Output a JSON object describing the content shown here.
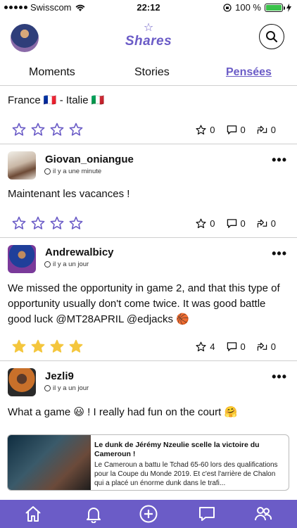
{
  "statusbar": {
    "carrier": "Swisscom",
    "time": "22:12",
    "battery": "100 %"
  },
  "header": {
    "logo_text": "Shares"
  },
  "tabs": [
    {
      "label": "Moments"
    },
    {
      "label": "Stories"
    },
    {
      "label": "Pensées",
      "active": true
    }
  ],
  "posts": [
    {
      "text": "France 🇫🇷 - Italie 🇮🇹",
      "stars_filled": 0,
      "likes": "0",
      "comments": "0",
      "shares": "0"
    },
    {
      "author": "Giovan_oniangue",
      "time": "il y a une minute",
      "text": "Maintenant les vacances !",
      "stars_filled": 0,
      "likes": "0",
      "comments": "0",
      "shares": "0"
    },
    {
      "author": "Andrewalbicy",
      "time": "il y a un jour",
      "text": "We missed the opportunity in game 2, and that this type of opportunity usually don't come twice. It was good battle good luck @MT28APRIL @edjacks 🏀",
      "stars_filled": 4,
      "likes": "4",
      "comments": "0",
      "shares": "0"
    },
    {
      "author": "Jezli9",
      "time": "il y a un jour",
      "text": "What a game 😃 ! I really had fun on the court 🤗",
      "link": {
        "title": "Le dunk de Jérémy Nzeulie scelle la victoire du Cameroun !",
        "description": "Le Cameroun a battu le Tchad 65-60 lors des qualifications pour la Coupe du Monde 2019. Et c'est l'arrière de Chalon qui a placé un énorme dunk dans le trafi..."
      }
    }
  ],
  "colors": {
    "accent": "#6b5cc7",
    "star_filled": "#f4c63d"
  }
}
